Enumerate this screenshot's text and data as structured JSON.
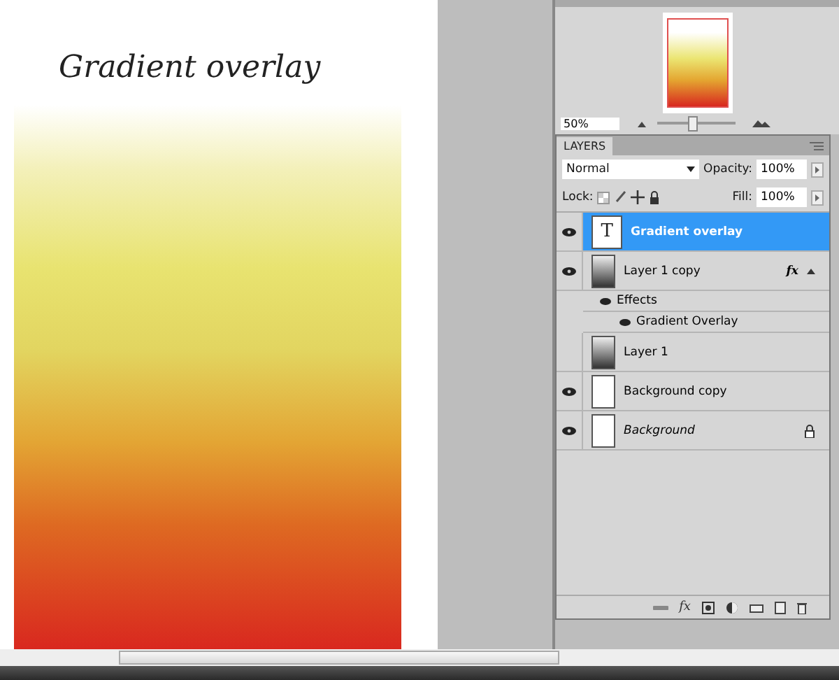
{
  "document": {
    "title": "Gradient overlay"
  },
  "navigator": {
    "zoom": "50%",
    "level": 0.45
  },
  "layers_panel": {
    "tab": "LAYERS",
    "blend_mode": "Normal",
    "opacity_label": "Opacity:",
    "opacity": "100%",
    "lock_label": "Lock:",
    "fill_label": "Fill:",
    "fill": "100%",
    "layers": [
      {
        "kind": "text",
        "thumb": "T",
        "name": "Gradient overlay",
        "visible": true,
        "selected": true,
        "italic": false,
        "locked": false
      },
      {
        "kind": "gradient",
        "name": "Layer 1 copy",
        "visible": true,
        "selected": false,
        "italic": false,
        "locked": false,
        "fx_label": "fx",
        "effects_label": "Effects",
        "effects": [
          {
            "name": "Gradient Overlay",
            "visible": true
          }
        ]
      },
      {
        "kind": "gradient",
        "name": "Layer 1",
        "visible": false,
        "selected": false,
        "italic": false,
        "locked": false
      },
      {
        "kind": "white",
        "name": "Background copy",
        "visible": true,
        "selected": false,
        "italic": false,
        "locked": false
      },
      {
        "kind": "white",
        "name": "Background",
        "visible": true,
        "selected": false,
        "italic": true,
        "locked": true
      }
    ],
    "style_button": "fx"
  }
}
